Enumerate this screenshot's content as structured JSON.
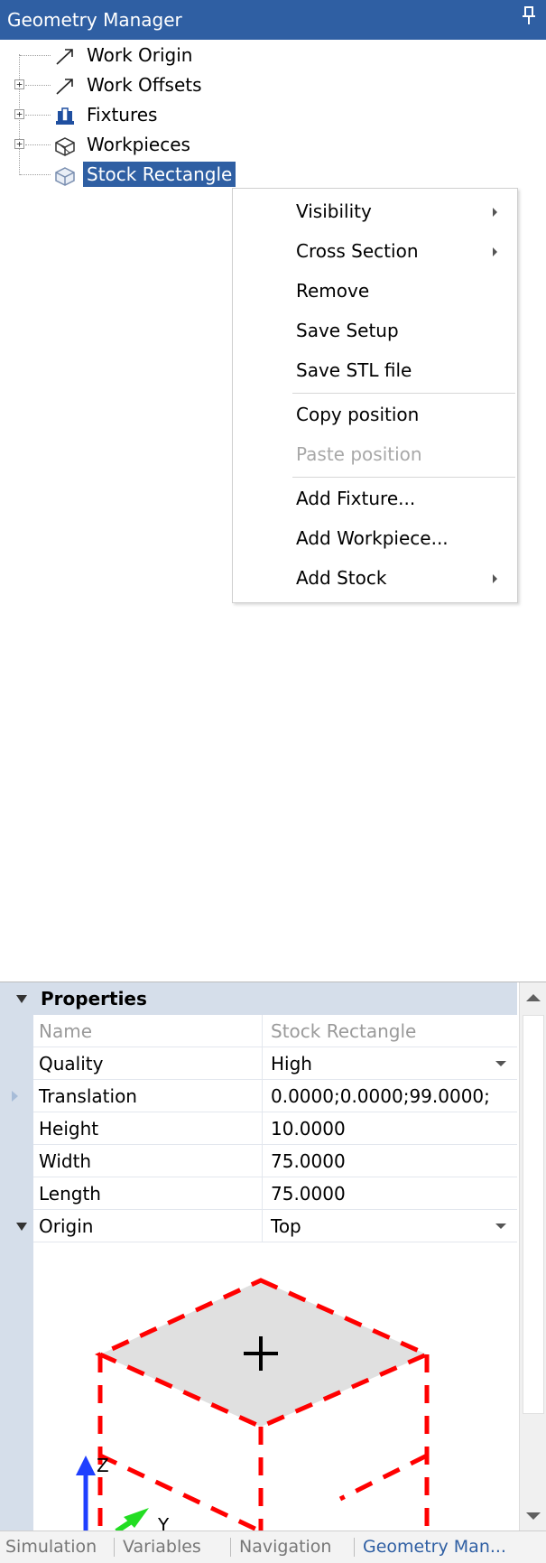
{
  "panel": {
    "title": "Geometry Manager",
    "pin_glyph": "Ԅ"
  },
  "tree": {
    "items": [
      {
        "label": "Work Origin",
        "icon": "arrow-icon",
        "expandable": false
      },
      {
        "label": "Work Offsets",
        "icon": "arrow-icon",
        "expandable": true
      },
      {
        "label": "Fixtures",
        "icon": "fixture-icon",
        "expandable": true
      },
      {
        "label": "Workpieces",
        "icon": "workpiece-icon",
        "expandable": true
      },
      {
        "label": "Stock Rectangle",
        "icon": "stock-box-icon",
        "expandable": false,
        "selected": true
      }
    ],
    "expander_glyph": "+"
  },
  "context_menu": {
    "items": [
      {
        "label": "Visibility",
        "submenu": true,
        "enabled": true
      },
      {
        "label": "Cross Section",
        "submenu": true,
        "enabled": true
      },
      {
        "label": "Remove",
        "submenu": false,
        "enabled": true
      },
      {
        "label": "Save Setup",
        "submenu": false,
        "enabled": true
      },
      {
        "label": "Save STL file",
        "submenu": false,
        "enabled": true
      },
      {
        "label": "Copy position",
        "submenu": false,
        "enabled": true
      },
      {
        "label": "Paste position",
        "submenu": false,
        "enabled": false
      },
      {
        "label": "Add Fixture...",
        "submenu": false,
        "enabled": true
      },
      {
        "label": "Add Workpiece...",
        "submenu": false,
        "enabled": true
      },
      {
        "label": "Add Stock",
        "submenu": true,
        "enabled": true
      }
    ]
  },
  "properties": {
    "header": "Properties",
    "rows": [
      {
        "name": "Name",
        "value": "Stock Rectangle",
        "readonly": true
      },
      {
        "name": "Quality",
        "value": "High",
        "dropdown": true
      },
      {
        "name": "Translation",
        "value": "0.0000;0.0000;99.0000;",
        "collapsed": true
      },
      {
        "name": "Height",
        "value": "10.0000"
      },
      {
        "name": "Width",
        "value": "75.0000"
      },
      {
        "name": "Length",
        "value": "75.0000"
      },
      {
        "name": "Origin",
        "value": "Top",
        "dropdown": true,
        "expanded": true
      }
    ],
    "preview": {
      "axis_z": "Z",
      "axis_y": "Y",
      "origin_marker": "+",
      "colors": {
        "dash": "#ff0000",
        "top_face": "#e0e0e0",
        "z_axis": "#1f3fff",
        "y_axis": "#22dd22"
      }
    }
  },
  "bottom_tabs": [
    {
      "label": "Simulation",
      "active": false
    },
    {
      "label": "Variables",
      "active": false
    },
    {
      "label": "Navigation",
      "active": false
    },
    {
      "label": "Geometry Man...",
      "active": true
    }
  ],
  "colors": {
    "accent": "#2f5fa3",
    "prop_gutter": "#d5deea"
  }
}
